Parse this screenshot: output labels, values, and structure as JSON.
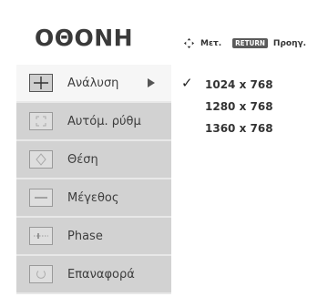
{
  "header": {
    "title": "ΟΘΟΝΗ",
    "hint_move_icon": "move-arrows-icon",
    "hint_move_label": "Μετ.",
    "hint_return_key": "RETURN",
    "hint_return_label": "Προηγ."
  },
  "menu": {
    "items": [
      {
        "label": "Ανάλυση",
        "icon": "resolution-icon",
        "selected": true
      },
      {
        "label": "Αυτόμ. ρύθμ",
        "icon": "auto-config-icon",
        "selected": false
      },
      {
        "label": "Θέση",
        "icon": "position-icon",
        "selected": false
      },
      {
        "label": "Μέγεθος",
        "icon": "size-icon",
        "selected": false
      },
      {
        "label": "Phase",
        "icon": "phase-icon",
        "selected": false
      },
      {
        "label": "Επαναφορά",
        "icon": "reset-icon",
        "selected": false
      }
    ]
  },
  "resolution_options": [
    {
      "label": "1024 x 768",
      "checked": true
    },
    {
      "label": "1280 x 768",
      "checked": false
    },
    {
      "label": "1360 x 768",
      "checked": false
    }
  ],
  "colors": {
    "title": "#3a3a3a",
    "menu_bg": "#d2d2d2",
    "menu_selected_bg": "#f6f6f6",
    "return_key_bg": "#5a5a5a"
  }
}
